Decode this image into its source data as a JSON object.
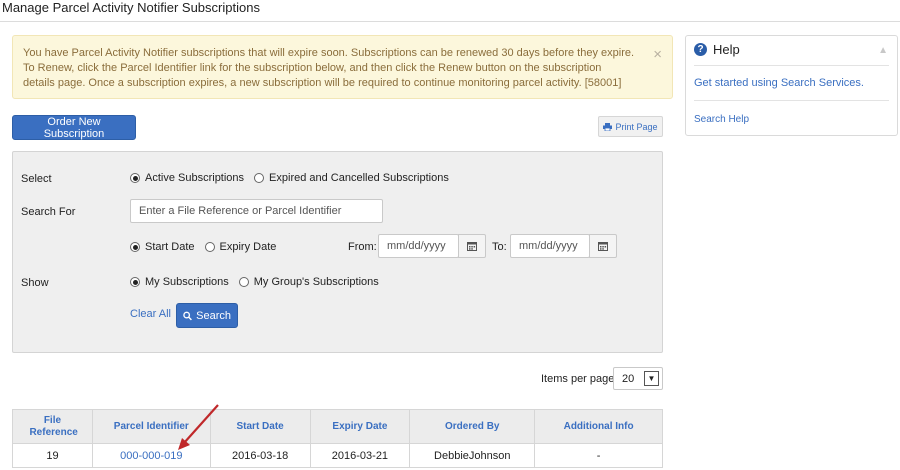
{
  "page": {
    "title": "Manage Parcel Activity Notifier Subscriptions"
  },
  "alert": {
    "message": "You have Parcel Activity Notifier subscriptions that will expire soon. Subscriptions can be renewed 30 days before they expire. To Renew, click the Parcel Identifier link for the subscription below, and then click the Renew button on the subscription details page. Once a subscription expires, a new subscription will be required to continue monitoring parcel activity. [58001]",
    "close_glyph": "×"
  },
  "toolbar": {
    "order_label": "Order New Subscription",
    "print_label": "Print Page",
    "print_icon": "printer-icon"
  },
  "search": {
    "select_label": "Select",
    "select_options": [
      {
        "label": "Active Subscriptions",
        "checked": true
      },
      {
        "label": "Expired and Cancelled Subscriptions",
        "checked": false
      }
    ],
    "search_for_label": "Search For",
    "search_placeholder": "Enter a File Reference or Parcel Identifier",
    "date_options": [
      {
        "label": "Start Date",
        "checked": true
      },
      {
        "label": "Expiry Date",
        "checked": false
      }
    ],
    "from_label": "From:",
    "to_label": "To:",
    "date_placeholder": "mm/dd/yyyy",
    "show_label": "Show",
    "show_options": [
      {
        "label": "My Subscriptions",
        "checked": true
      },
      {
        "label": "My Group's Subscriptions",
        "checked": false
      }
    ],
    "clear_label": "Clear All",
    "search_button_label": "Search"
  },
  "help": {
    "title": "Help",
    "link_primary": "Get started using Search Services.",
    "link_secondary": "Search Help"
  },
  "pagination": {
    "items_per_page_label": "Items per page",
    "items_per_page_value": "20"
  },
  "table": {
    "columns": [
      "File Reference",
      "Parcel Identifier",
      "Start Date",
      "Expiry Date",
      "Ordered By",
      "Additional Info"
    ],
    "rows": [
      {
        "file_reference": "19",
        "parcel_identifier": "000-000-019",
        "start_date": "2016-03-18",
        "expiry_date": "2016-03-21",
        "ordered_by": "DebbieJohnson",
        "additional_info": "-"
      }
    ]
  },
  "colors": {
    "accent": "#3a6fc1",
    "alert_bg": "#fcf7dc",
    "alert_text": "#8a6d3b",
    "annotation_arrow": "#c0282a"
  }
}
